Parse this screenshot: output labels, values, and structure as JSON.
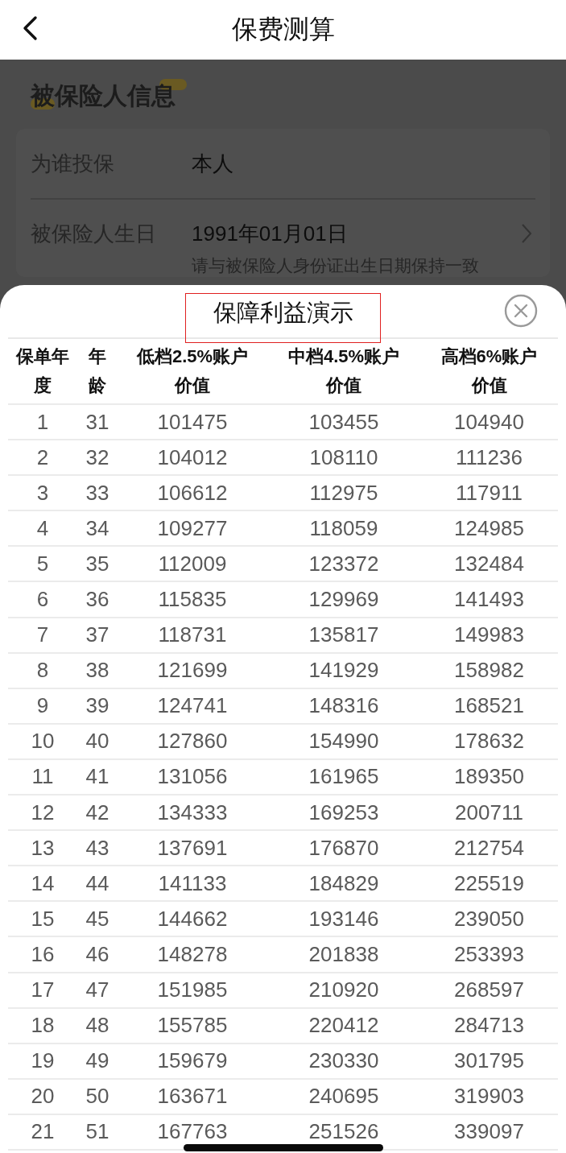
{
  "nav": {
    "title": "保费测算"
  },
  "section": {
    "title": "被保险人信息"
  },
  "fields": [
    {
      "kind": "static",
      "label": "为谁投保",
      "value": "本人"
    },
    {
      "kind": "picker",
      "label": "被保险人生日",
      "value": "1991年01月01日",
      "hint": "请与被保险人身份证出生日期保持一致"
    }
  ],
  "sheet": {
    "title": "保障利益演示",
    "columns": [
      "保单年度",
      "年龄",
      "低档2.5%账户价值",
      "中档4.5%账户价值",
      "高档6%账户价值"
    ],
    "rows": [
      [
        "1",
        "31",
        "101475",
        "103455",
        "104940"
      ],
      [
        "2",
        "32",
        "104012",
        "108110",
        "111236"
      ],
      [
        "3",
        "33",
        "106612",
        "112975",
        "117911"
      ],
      [
        "4",
        "34",
        "109277",
        "118059",
        "124985"
      ],
      [
        "5",
        "35",
        "112009",
        "123372",
        "132484"
      ],
      [
        "6",
        "36",
        "115835",
        "129969",
        "141493"
      ],
      [
        "7",
        "37",
        "118731",
        "135817",
        "149983"
      ],
      [
        "8",
        "38",
        "121699",
        "141929",
        "158982"
      ],
      [
        "9",
        "39",
        "124741",
        "148316",
        "168521"
      ],
      [
        "10",
        "40",
        "127860",
        "154990",
        "178632"
      ],
      [
        "11",
        "41",
        "131056",
        "161965",
        "189350"
      ],
      [
        "12",
        "42",
        "134333",
        "169253",
        "200711"
      ],
      [
        "13",
        "43",
        "137691",
        "176870",
        "212754"
      ],
      [
        "14",
        "44",
        "141133",
        "184829",
        "225519"
      ],
      [
        "15",
        "45",
        "144662",
        "193146",
        "239050"
      ],
      [
        "16",
        "46",
        "148278",
        "201838",
        "253393"
      ],
      [
        "17",
        "47",
        "151985",
        "210920",
        "268597"
      ],
      [
        "18",
        "48",
        "155785",
        "220412",
        "284713"
      ],
      [
        "19",
        "49",
        "159679",
        "230330",
        "301795"
      ],
      [
        "20",
        "50",
        "163671",
        "240695",
        "319903"
      ],
      [
        "21",
        "51",
        "167763",
        "251526",
        "339097"
      ]
    ]
  }
}
